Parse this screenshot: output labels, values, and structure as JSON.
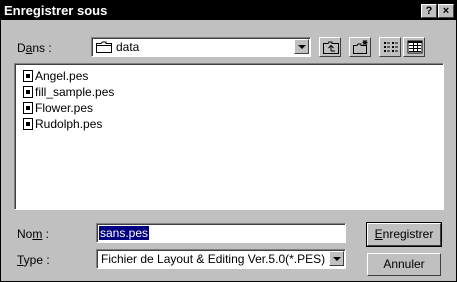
{
  "window": {
    "title": "Enregistrer sous",
    "help_label": "?",
    "close_label": "×"
  },
  "look_in": {
    "label_pre": "D",
    "label_accel": "a",
    "label_post": "ns :",
    "value": "data"
  },
  "toolbar": {
    "icons": [
      "folder-up-icon",
      "new-folder-icon",
      "list-view-icon",
      "details-view-icon"
    ]
  },
  "files": [
    {
      "name": "Angel.pes"
    },
    {
      "name": "fill_sample.pes"
    },
    {
      "name": "Flower.pes"
    },
    {
      "name": "Rudolph.pes"
    }
  ],
  "filename": {
    "label_pre": "No",
    "label_accel": "m",
    "label_post": " :",
    "value": "sans.pes"
  },
  "filetype": {
    "label_pre": "",
    "label_accel": "T",
    "label_post": "ype :",
    "value": "Fichier de Layout & Editing Ver.5.0(*.PES)"
  },
  "buttons": {
    "save_pre": "",
    "save_accel": "E",
    "save_post": "nregistrer",
    "cancel": "Annuler"
  },
  "colors": {
    "face": "#c0c0c0",
    "titlebar": "#000000",
    "selection": "#000080"
  }
}
